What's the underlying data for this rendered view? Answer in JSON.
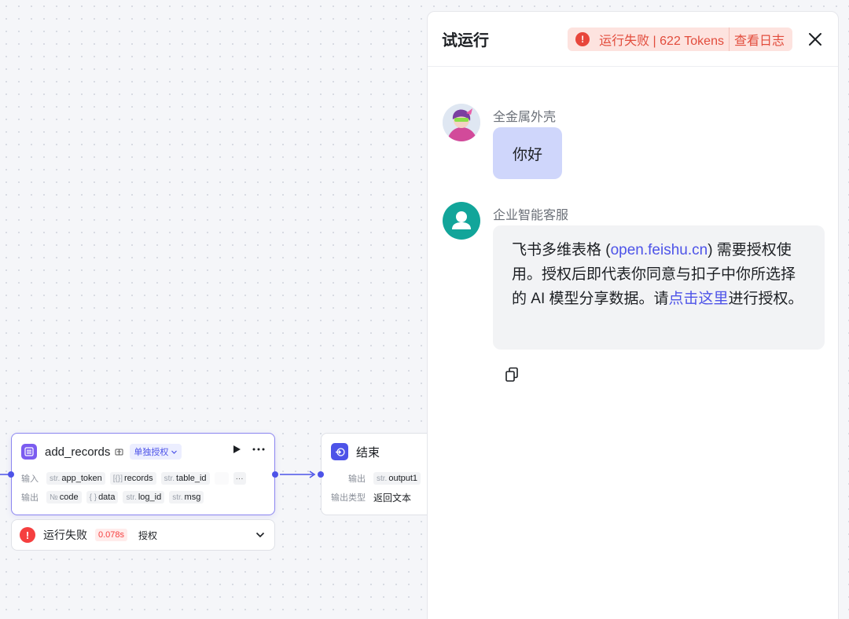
{
  "canvas": {
    "add_node": {
      "title": "add_records",
      "auth_tag": "单独授权",
      "input_label": "输入",
      "output_label": "输出",
      "inputs": [
        {
          "prefix": "str.",
          "name": "app_token"
        },
        {
          "prefix": "[{}]",
          "name": "records"
        },
        {
          "prefix": "str.",
          "name": "table_id"
        }
      ],
      "outputs": [
        {
          "prefix": "№",
          "name": "code"
        },
        {
          "prefix": "{ }",
          "name": "data"
        },
        {
          "prefix": "str.",
          "name": "log_id"
        },
        {
          "prefix": "str.",
          "name": "msg"
        }
      ],
      "more": "···"
    },
    "end_node": {
      "title": "结束",
      "output_label": "输出",
      "output_prefix": "str.",
      "output_name": "output1",
      "type_label": "输出类型",
      "type_value": "返回文本"
    },
    "status": {
      "icon": "!",
      "text": "运行失败",
      "time": "0.078s",
      "auth": "授权"
    }
  },
  "panel": {
    "title": "试运行",
    "badge": {
      "icon": "!",
      "status": "运行失败 | 622 Tokens",
      "log": "查看日志"
    },
    "messages": {
      "user": {
        "name": "全金属外壳",
        "text": "你好"
      },
      "bot": {
        "name": "企业智能客服",
        "t1": "飞书多维表格 (",
        "link1": "open.feishu.cn",
        "t2": ") 需要授权使用。授权后即代表你同意与扣子中你所选择的 AI 模型分享数据。请",
        "link2": "点击这里",
        "t3": "进行授权。"
      }
    }
  },
  "colors": {
    "accent": "#4d53e8",
    "error": "#f53f3f",
    "user_bubble": "#cfd6fb",
    "bot_avatar": "#12a59a"
  }
}
